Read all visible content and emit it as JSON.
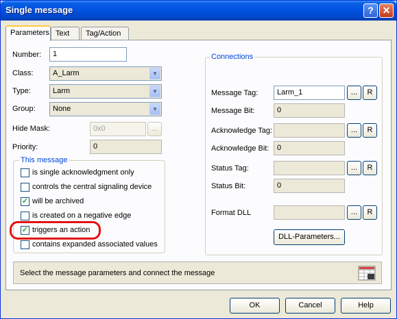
{
  "window": {
    "title": "Single message",
    "help_glyph": "?",
    "close_glyph": "✕"
  },
  "tabs": [
    {
      "label": "Parameters"
    },
    {
      "label": "Text"
    },
    {
      "label": "Tag/Action"
    }
  ],
  "params": {
    "number_label": "Number:",
    "number_value": "1",
    "class_label": "Class:",
    "class_value": "A_Larm",
    "type_label": "Type:",
    "type_value": "Larm",
    "group_label": "Group:",
    "group_value": "None",
    "hide_mask_label": "Hide Mask:",
    "hide_mask_value": "0x0",
    "priority_label": "Priority:",
    "priority_value": "0"
  },
  "this_message": {
    "title": "This message",
    "options": [
      {
        "label": "is single acknowledgment only",
        "checked": false
      },
      {
        "label": "controls the central signaling device",
        "checked": false
      },
      {
        "label": "will be archived",
        "checked": true
      },
      {
        "label": "is created on a negative edge",
        "checked": false
      },
      {
        "label": "triggers an action",
        "checked": true
      },
      {
        "label": "contains expanded associated values",
        "checked": false
      }
    ]
  },
  "connections": {
    "title": "Connections",
    "message_tag_label": "Message Tag:",
    "message_tag_value": "Larm_1",
    "message_bit_label": "Message Bit:",
    "message_bit_value": "0",
    "ack_tag_label": "Acknowledge Tag:",
    "ack_tag_value": "",
    "ack_bit_label": "Acknowledge Bit:",
    "ack_bit_value": "0",
    "status_tag_label": "Status Tag:",
    "status_tag_value": "",
    "status_bit_label": "Status Bit:",
    "status_bit_value": "0",
    "format_dll_label": "Format DLL",
    "format_dll_value": "",
    "browse_label": "...",
    "r_label": "R",
    "dll_params_button": "DLL-Parameters..."
  },
  "status": {
    "text": "Select the message parameters and connect the message",
    "icon": "table-icon"
  },
  "footer": {
    "ok": "OK",
    "cancel": "Cancel",
    "help": "Help"
  },
  "colors": {
    "title_bar": "#0053e1",
    "group_title": "#0046d5",
    "highlight": "#e31010",
    "check": "#21a121"
  }
}
